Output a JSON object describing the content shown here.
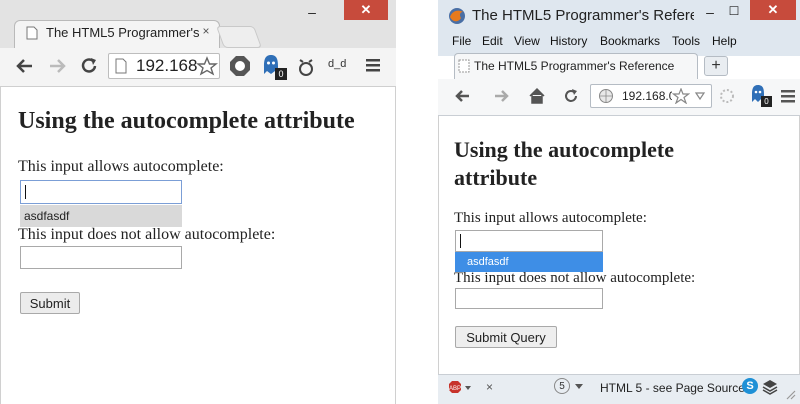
{
  "chrome": {
    "tab_title": "The HTML5 Programmer's",
    "address": "192.168",
    "minimize": "–",
    "close": "✕",
    "tab_close": "×",
    "extension_badge": "0",
    "extension_text": "d_d",
    "page": {
      "heading": "Using the autocomplete attribute",
      "label_allow": "This input allows autocomplete:",
      "suggestion": "asdfasdf",
      "label_disallow": "This input does not allow autocomplete:",
      "submit": "Submit"
    }
  },
  "firefox": {
    "window_title": "The HTML5 Programmer's Refere",
    "minimize": "–",
    "maximize": "☐",
    "close": "✕",
    "menu": [
      "File",
      "Edit",
      "View",
      "History",
      "Bookmarks",
      "Tools",
      "Help"
    ],
    "tab_title": "The HTML5 Programmer's Reference",
    "newtab": "+",
    "address": "192.168.0",
    "extension_badge": "0",
    "page": {
      "heading": "Using the autocomplete attribute",
      "label_allow": "This input allows autocomplete:",
      "suggestion": "asdfasdf",
      "label_disallow": "This input does not allow autocomplete:",
      "submit": "Submit Query"
    },
    "status": {
      "count": "5",
      "close": "×",
      "text": "HTML 5 - see Page Source"
    }
  },
  "colors": {
    "chrome_close": "#c74b3c",
    "firefox_highlight": "#3e8ee6",
    "chrome_suggestion_bg": "#d9d9d9"
  }
}
